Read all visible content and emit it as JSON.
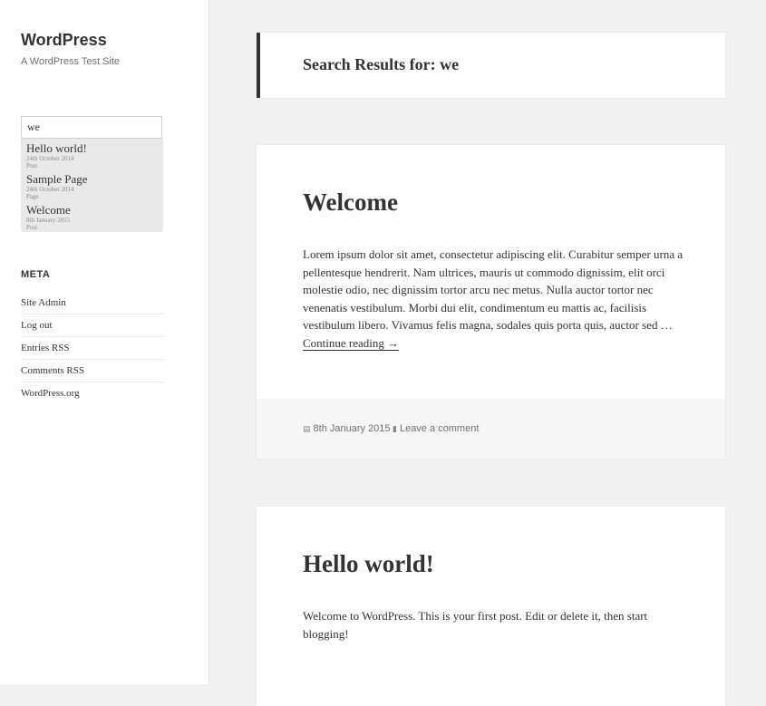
{
  "site": {
    "title": "WordPress",
    "description": "A WordPress Test Site"
  },
  "search": {
    "value": "we"
  },
  "suggestions": [
    {
      "title": "Hello world!",
      "date": "24th October 2014",
      "type": "Post"
    },
    {
      "title": "Sample Page",
      "date": "24th October 2014",
      "type": "Page"
    },
    {
      "title": "Welcome",
      "date": "8th January 2015",
      "type": "Post"
    }
  ],
  "meta_widget": {
    "title": "META",
    "links": [
      "Site Admin",
      "Log out",
      "Entries RSS",
      "Comments RSS",
      "WordPress.org"
    ]
  },
  "page_header": {
    "title": "Search Results for: we"
  },
  "posts": [
    {
      "title": "Welcome",
      "excerpt": "Lorem ipsum dolor sit amet, consectetur adipiscing elit. Curabitur semper urna a pellentesque hendrerit. Nam ultrices, mauris ut commodo dignissim, elit orci molestie odio, nec dignissim tortor arcu nec metus. Nulla auctor tortor nec venenatis vestibulum. Morbi dui elit, condimentum eu mattis ac, facilisis vestibulum libero. Vivamus felis magna, sodales quis porta quis, auctor sed …",
      "continue_label": "Continue reading →",
      "date": "8th January 2015",
      "comment_label": "Leave a comment"
    },
    {
      "title": "Hello world!",
      "excerpt": "Welcome to WordPress. This is your first post. Edit or delete it, then start blogging!"
    }
  ],
  "icons": {
    "date": "calendar-icon",
    "comment": "comment-icon"
  }
}
